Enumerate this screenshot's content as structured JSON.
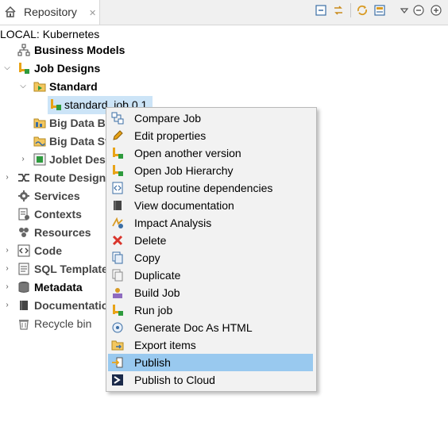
{
  "view": {
    "tab_title": "Repository",
    "close_glyph": "✕"
  },
  "connection_label": "LOCAL: Kubernetes",
  "tree": {
    "business_models": "Business Models",
    "job_designs": "Job Designs",
    "standard": "Standard",
    "standard_job": "standard_job 0.1",
    "big_data_batch": "Big Data Batch",
    "big_data_streaming": "Big Data Streaming",
    "joblet_designs": "Joblet Designs",
    "route_designs": "Route Designs",
    "services": "Services",
    "contexts": "Contexts",
    "resources": "Resources",
    "code": "Code",
    "sql_templates": "SQL Templates",
    "metadata": "Metadata",
    "documentation": "Documentation",
    "recycle_bin": "Recycle bin"
  },
  "context_menu": {
    "items": [
      {
        "label": "Compare Job",
        "icon": "compare-icon"
      },
      {
        "label": "Edit properties",
        "icon": "pencil-icon"
      },
      {
        "label": "Open another version",
        "icon": "job-icon"
      },
      {
        "label": "Open Job Hierarchy",
        "icon": "job-icon"
      },
      {
        "label": "Setup routine dependencies",
        "icon": "routine-icon"
      },
      {
        "label": "View documentation",
        "icon": "book-icon"
      },
      {
        "label": "Impact Analysis",
        "icon": "impact-icon"
      },
      {
        "label": "Delete",
        "icon": "delete-icon"
      },
      {
        "label": "Copy",
        "icon": "copy-icon"
      },
      {
        "label": "Duplicate",
        "icon": "duplicate-icon"
      },
      {
        "label": "Build Job",
        "icon": "build-icon"
      },
      {
        "label": "Run job",
        "icon": "job-icon"
      },
      {
        "label": "Generate Doc As HTML",
        "icon": "doc-gear-icon"
      },
      {
        "label": "Export items",
        "icon": "export-icon"
      },
      {
        "label": "Publish",
        "icon": "publish-icon"
      },
      {
        "label": "Publish to Cloud",
        "icon": "cloud-publish-icon"
      }
    ],
    "highlighted": "Publish"
  },
  "colors": {
    "selection": "#cce4f7",
    "menu_highlight": "#99c9ef",
    "menu_bg": "#f2f2f2"
  }
}
